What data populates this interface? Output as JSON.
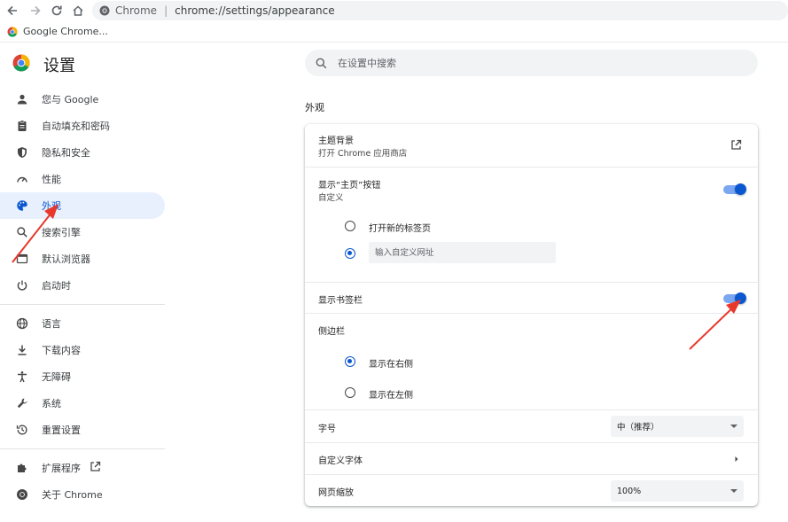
{
  "browser": {
    "omnibox": {
      "site": "Chrome",
      "url": "chrome://settings/appearance"
    },
    "bookmark": {
      "label": "Google Chrome..."
    }
  },
  "header": {
    "title": "设置",
    "search_placeholder": "在设置中搜索"
  },
  "sidebar": {
    "items": [
      {
        "label": "您与 Google",
        "icon": "person-icon"
      },
      {
        "label": "自动填充和密码",
        "icon": "clipboard-icon"
      },
      {
        "label": "隐私和安全",
        "icon": "shield-icon"
      },
      {
        "label": "性能",
        "icon": "speedometer-icon"
      },
      {
        "label": "外观",
        "icon": "palette-icon",
        "active": true
      },
      {
        "label": "搜索引擎",
        "icon": "search-icon"
      },
      {
        "label": "默认浏览器",
        "icon": "browser-window-icon"
      },
      {
        "label": "启动时",
        "icon": "power-icon"
      },
      {
        "label": "语言",
        "icon": "globe-icon"
      },
      {
        "label": "下载内容",
        "icon": "download-icon"
      },
      {
        "label": "无障碍",
        "icon": "accessibility-icon"
      },
      {
        "label": "系统",
        "icon": "wrench-icon"
      },
      {
        "label": "重置设置",
        "icon": "history-icon"
      },
      {
        "label": "扩展程序",
        "icon": "puzzle-icon"
      },
      {
        "label": "关于 Chrome",
        "icon": "chrome-icon"
      }
    ]
  },
  "main": {
    "section_title": "外观",
    "theme": {
      "title": "主题背景",
      "subtitle": "打开 Chrome 应用商店"
    },
    "home_button": {
      "title": "显示“主页”按钮",
      "subtitle": "自定义",
      "enabled": true,
      "options": [
        "打开新的标签页",
        "输入自定义网址"
      ],
      "selected": 1,
      "url_placeholder": "输入自定义网址"
    },
    "bookmarks_bar": {
      "title": "显示书签栏",
      "enabled": true
    },
    "side_panel": {
      "title": "侧边栏",
      "options": [
        "显示在右侧",
        "显示在左侧"
      ],
      "selected": 0
    },
    "font_size": {
      "title": "字号",
      "value": "中（推荐）"
    },
    "custom_fonts": {
      "title": "自定义字体"
    },
    "page_zoom": {
      "title": "网页缩放",
      "value": "100%"
    }
  },
  "colors": {
    "accent": "#0b57d0",
    "active_bg": "#e8f0fe",
    "annotation_arrow": "#e8382c"
  }
}
